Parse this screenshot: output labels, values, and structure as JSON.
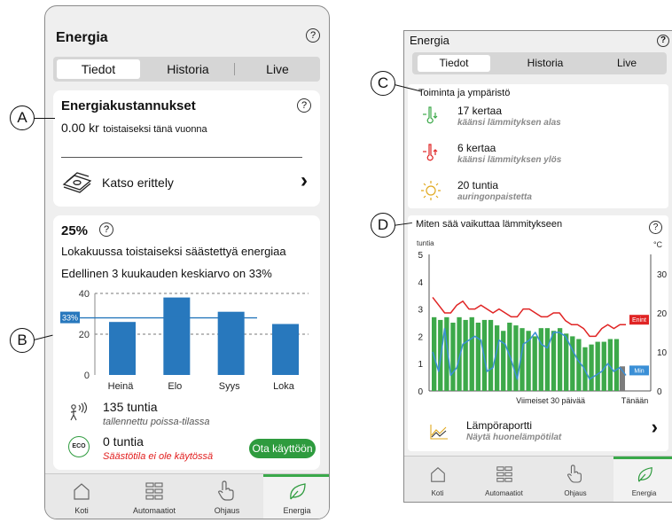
{
  "callouts": {
    "a": "A",
    "b": "B",
    "c": "C",
    "d": "D"
  },
  "phone_a": {
    "title": "Energia",
    "help_icon": "?",
    "tabs": [
      {
        "label": "Tiedot",
        "active": true
      },
      {
        "label": "Historia",
        "active": false
      },
      {
        "label": "Live",
        "active": false
      }
    ],
    "costs": {
      "title": "Energiakustannukset",
      "amount": "0.00 kr",
      "amount_note": "toistaiseksi tänä vuonna",
      "breakdown_label": "Katso erittely",
      "breakdown_icon": "money-icon",
      "chevron": "›"
    },
    "savings": {
      "percent": "25%",
      "line1": "Lokakuussa toistaiseksi säästettyä energiaa",
      "line2": "Edellinen 3 kuukauden keskiarvo on 33%",
      "away_hours": "135 tuntia",
      "away_note": "tallennettu poissa-tilassa",
      "eco_hours": "0 tuntia",
      "eco_note": "Säästötila ei ole käytössä",
      "eco_badge": "ECO",
      "eco_button": "Ota käyttöön",
      "accent": "#2e9b3e",
      "warning_color": "#e11b1b"
    },
    "nav": [
      {
        "label": "Koti",
        "icon": "home-icon",
        "active": false
      },
      {
        "label": "Automaatiot",
        "icon": "grid-icon",
        "active": false
      },
      {
        "label": "Ohjaus",
        "icon": "hand-icon",
        "active": false
      },
      {
        "label": "Energia",
        "icon": "leaf-icon",
        "active": true
      }
    ]
  },
  "phone_b": {
    "title": "Energia",
    "help_icon": "?",
    "tabs": [
      {
        "label": "Tiedot",
        "active": true
      },
      {
        "label": "Historia",
        "active": false
      },
      {
        "label": "Live",
        "active": false
      }
    ],
    "activity": {
      "title": "Toiminta ja ympäristö",
      "items": [
        {
          "value": "17 kertaa",
          "note": "käänsi lämmityksen alas",
          "icon": "thermometer-down-icon"
        },
        {
          "value": "6 kertaa",
          "note": "käänsi lämmityksen ylös",
          "icon": "thermometer-up-icon"
        },
        {
          "value": "20 tuntia",
          "note": "auringonpaistetta",
          "icon": "sun-icon"
        }
      ]
    },
    "weather": {
      "title": "Miten sää vaikuttaa lämmitykseen",
      "report_title": "Lämpöraportti",
      "report_note": "Näytä huonelämpötilat",
      "chevron": "›"
    },
    "nav": [
      {
        "label": "Koti",
        "icon": "home-icon",
        "active": false
      },
      {
        "label": "Automaatiot",
        "icon": "grid-icon",
        "active": false
      },
      {
        "label": "Ohjaus",
        "icon": "hand-icon",
        "active": false
      },
      {
        "label": "Energia",
        "icon": "leaf-icon",
        "active": true
      }
    ]
  },
  "chart_data": [
    {
      "type": "bar",
      "categories": [
        "Heinä",
        "Elo",
        "Syys",
        "Loka"
      ],
      "values": [
        26,
        38,
        31,
        25
      ],
      "ylim": [
        0,
        40
      ],
      "yticks": [
        0,
        20,
        40
      ],
      "reference_line": {
        "value": 28,
        "label": "33%"
      },
      "color": "#2878bd",
      "grid": "dashed at 20 and 40"
    },
    {
      "type": "bar",
      "left_axis_label": "tuntia",
      "right_axis_label": "°C",
      "xlabel": "Viimeiset 30 päivää",
      "today_label": "Tänään",
      "ylim": [
        0,
        5
      ],
      "yticks": [
        0,
        1,
        2,
        3,
        4,
        5
      ],
      "y2lim": [
        0,
        35
      ],
      "y2ticks": [
        0,
        10,
        20,
        30
      ],
      "bar_color": "#3da94a",
      "today_bar_color": "#7c7c7c",
      "values": [
        2.7,
        2.6,
        2.7,
        2.5,
        2.7,
        2.6,
        2.7,
        2.5,
        2.6,
        2.6,
        2.4,
        2.2,
        2.5,
        2.4,
        2.3,
        2.2,
        2.0,
        2.3,
        2.3,
        2.2,
        2.3,
        2.1,
        2.0,
        1.9,
        1.6,
        1.7,
        1.8,
        1.8,
        1.9,
        1.9,
        0.9
      ],
      "series": [
        {
          "name": "Enint",
          "color": "#e02424",
          "values": [
            24,
            22,
            20,
            20,
            22,
            23,
            21,
            21,
            22,
            21,
            20,
            21,
            20,
            19,
            19,
            21,
            21,
            20,
            19,
            19,
            20,
            20,
            18,
            17,
            17,
            16,
            14,
            14,
            16,
            17,
            16,
            17,
            17
          ]
        },
        {
          "name": "Min",
          "color": "#3a8fd6",
          "values": [
            10,
            5,
            16,
            4,
            6,
            12,
            13,
            14,
            13,
            5,
            6,
            13,
            12,
            8,
            3,
            12,
            13,
            15,
            12,
            11,
            15,
            15,
            14,
            11,
            8,
            6,
            3,
            4,
            5,
            7,
            5,
            6,
            4
          ]
        }
      ]
    }
  ]
}
